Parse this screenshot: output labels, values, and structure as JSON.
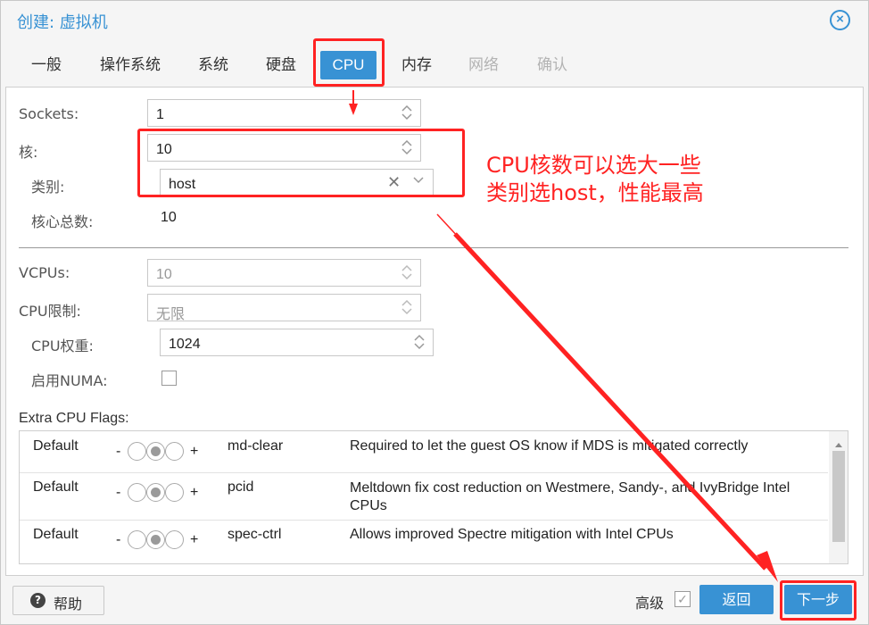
{
  "window": {
    "title": "创建: 虚拟机"
  },
  "tabs": [
    {
      "label": "一般",
      "state": "normal"
    },
    {
      "label": "操作系统",
      "state": "normal"
    },
    {
      "label": "系统",
      "state": "normal"
    },
    {
      "label": "硬盘",
      "state": "normal"
    },
    {
      "label": "CPU",
      "state": "active"
    },
    {
      "label": "内存",
      "state": "normal"
    },
    {
      "label": "网络",
      "state": "disabled"
    },
    {
      "label": "确认",
      "state": "disabled"
    }
  ],
  "form": {
    "sockets": {
      "label": "Sockets:",
      "value": "1"
    },
    "cores": {
      "label": "核:",
      "value": "10"
    },
    "type": {
      "label": "类别:",
      "value": "host"
    },
    "total_cores": {
      "label": "核心总数:",
      "value": "10"
    },
    "vcpus": {
      "label": "VCPUs:",
      "value": "10"
    },
    "cpu_limit": {
      "label": "CPU限制:",
      "value": "无限"
    },
    "cpu_weight": {
      "label": "CPU权重:",
      "value": "1024"
    },
    "numa": {
      "label": "启用NUMA:",
      "checked": false
    }
  },
  "flags": {
    "label": "Extra CPU Flags:",
    "rows": [
      {
        "state": "Default",
        "minus": "-",
        "plus": "+",
        "name": "md-clear",
        "desc": "Required to let the guest OS know if MDS is mitigated correctly"
      },
      {
        "state": "Default",
        "minus": "-",
        "plus": "+",
        "name": "pcid",
        "desc": "Meltdown fix cost reduction on Westmere, Sandy-, and IvyBridge Intel CPUs"
      },
      {
        "state": "Default",
        "minus": "-",
        "plus": "+",
        "name": "spec-ctrl",
        "desc": "Allows improved Spectre mitigation with Intel CPUs"
      }
    ]
  },
  "footer": {
    "help": "帮助",
    "advanced": "高级",
    "advanced_checked": true,
    "back": "返回",
    "next": "下一步"
  },
  "annotation": {
    "line1": "CPU核数可以选大一些",
    "line2": "类别选host，性能最高",
    "color": "#ff2222"
  },
  "colors": {
    "accent": "#3892d4"
  }
}
